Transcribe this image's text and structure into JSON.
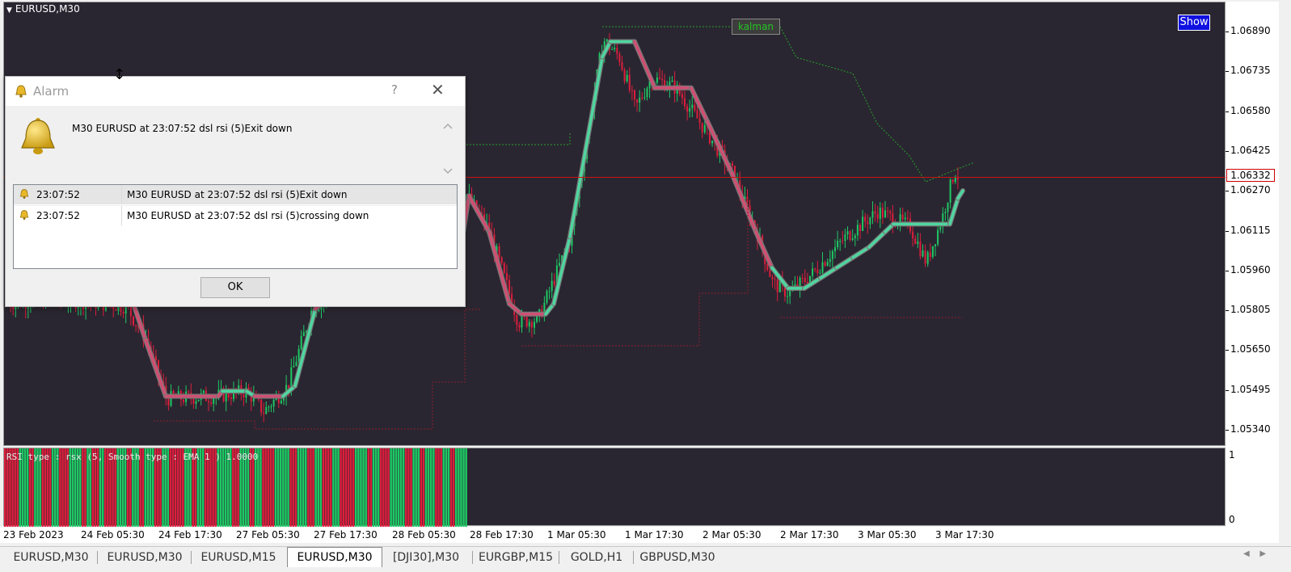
{
  "chart": {
    "title": "EURUSD,M30",
    "show_button": "Show",
    "kalman_label": "kalman",
    "current_price": "1.06332",
    "price_labels": [
      "1.06890",
      "1.06735",
      "1.06580",
      "1.06425",
      "1.06270",
      "1.06115",
      "1.05960",
      "1.05805",
      "1.05650",
      "1.05495",
      "1.05340"
    ],
    "time_labels": [
      "23 Feb 2023",
      "24 Feb 05:30",
      "24 Feb 17:30",
      "27 Feb 05:30",
      "27 Feb 17:30",
      "28 Feb 05:30",
      "28 Feb 17:30",
      "1 Mar 05:30",
      "1 Mar 17:30",
      "2 Mar 05:30",
      "2 Mar 17:30",
      "3 Mar 05:30",
      "3 Mar 17:30"
    ],
    "colors": {
      "background": "#2a2631",
      "bull": "#1ec864",
      "bear": "#dc1e3c",
      "line_up": "#4fd6a0",
      "line_down": "#d04f72"
    }
  },
  "subwindow": {
    "label": "RSI type : rsx (5, Smooth type : EMA  1 ) 1.0000",
    "scale_max": "1",
    "scale_min": "0"
  },
  "alarm": {
    "title": "Alarm",
    "help": "?",
    "message": "M30 EURUSD at 23:07:52 dsl rsi (5)Exit down",
    "entries": [
      {
        "time": "23:07:52",
        "message": "M30 EURUSD at 23:07:52 dsl rsi (5)Exit down"
      },
      {
        "time": "23:07:52",
        "message": "M30 EURUSD at 23:07:52 dsl rsi (5)crossing  down"
      }
    ],
    "ok_label": "OK"
  },
  "tabs": [
    {
      "label": "EURUSD,M30",
      "active": false
    },
    {
      "label": "EURUSD,M30",
      "active": false
    },
    {
      "label": "EURUSD,M15",
      "active": false
    },
    {
      "label": "EURUSD,M30",
      "active": true
    },
    {
      "label": "[DJI30],M30",
      "active": false
    },
    {
      "label": "EURGBP,M15",
      "active": false
    },
    {
      "label": "GOLD,H1",
      "active": false
    },
    {
      "label": "GBPUSD,M30",
      "active": false
    }
  ]
}
